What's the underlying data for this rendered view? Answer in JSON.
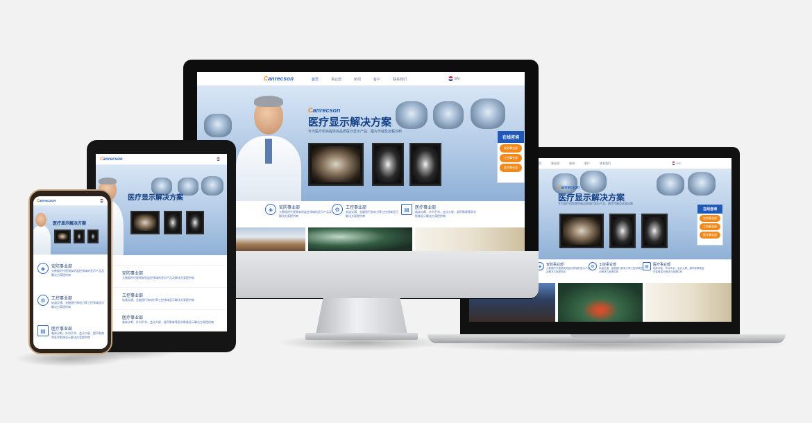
{
  "site": {
    "logo_text": "anrecson",
    "logo_initial": "C",
    "nav": [
      "首页",
      "事业部",
      "新闻",
      "客户",
      "联系我们"
    ],
    "lang": "EN",
    "hero_title": "医疗显示解决方案",
    "hero_sub": "专为医疗机构提供高品质医疗显示产品、图片传输及远程诊断",
    "chat_title": "在线咨询",
    "chat_buttons": [
      "安防事业部",
      "工控事业部",
      "医疗事业部"
    ],
    "divisions": [
      {
        "title": "安防事业部",
        "desc": "大数据时代视频安防监控领域的显示产品及解决方案提供商",
        "icon": "shield-icon"
      },
      {
        "title": "工控事业部",
        "desc": "轨道交通、金融银行和电力等工控领域显示解决方案提供商",
        "icon": "gear-icon"
      },
      {
        "title": "医疗事业部",
        "desc": "临床诊断、外科手术、会诊大屏、超声影像等医学影像显示解决方案提供商",
        "icon": "document-icon"
      }
    ]
  },
  "colors": {
    "brand_blue": "#1f58b8",
    "accent_orange": "#f08a1c",
    "background": "#f2f2f2"
  },
  "device_names": [
    "imac",
    "laptop",
    "tablet",
    "phone"
  ]
}
